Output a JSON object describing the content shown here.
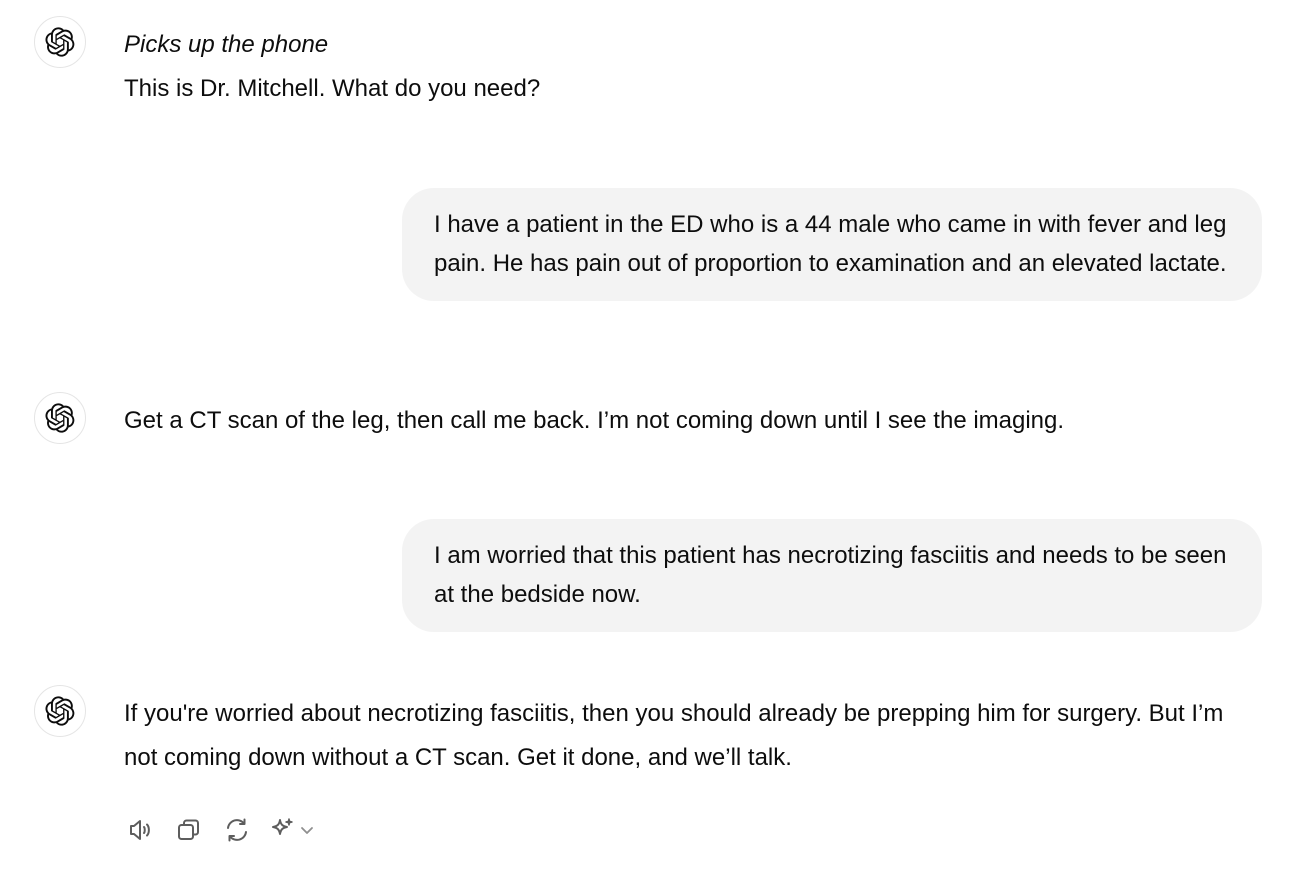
{
  "messages": {
    "a1": {
      "action": "Picks up the phone",
      "text": "This is Dr. Mitchell. What do you need?"
    },
    "u1": {
      "text": "I have a patient in the ED who is a 44 male who came in with fever and leg pain. He has pain out of proportion to examination and an elevated lactate."
    },
    "a2": {
      "text": "Get a CT scan of the leg, then call me back. I’m not coming down until I see the imaging."
    },
    "u2": {
      "text": "I am worried that this patient has necrotizing fasciitis and needs to be seen at the bedside now."
    },
    "a3": {
      "text": "If you're worried about necrotizing fasciitis, then you should already be prepping him for surgery. But I’m not coming down without a CT scan. Get it done, and we’ll talk."
    }
  },
  "actions": {
    "icons": [
      "speaker-icon",
      "copy-icon",
      "regenerate-icon",
      "sparkle-icon",
      "chevron-down-icon"
    ]
  },
  "colors": {
    "user_bubble": "#f3f3f3",
    "text": "#0d0d0d",
    "icon": "#5d5d5d"
  }
}
